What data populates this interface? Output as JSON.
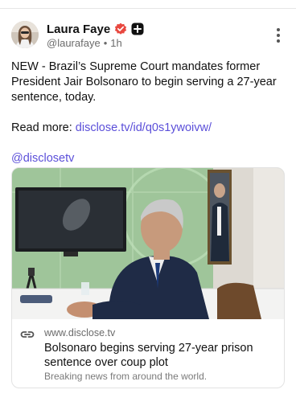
{
  "author": {
    "display_name": "Laura Faye",
    "handle": "@laurafaye",
    "separator": "•",
    "time_ago": "1h",
    "verified_icon": "verified-badge-icon",
    "plus_icon": "plus-badge-icon"
  },
  "post": {
    "text": "NEW - Brazil’s Supreme Court mandates former President Jair Bolsonaro to begin serving a 27-year sentence, today.",
    "read_more_label": "Read more:",
    "read_more_link": "disclose.tv/id/q0s1ywoivw/",
    "mention": "@disclosetv"
  },
  "link_card": {
    "domain": "www.disclose.tv",
    "title": "Bolsonaro begins serving 27-year prison sentence over coup plot",
    "description": "Breaking news from around the world."
  },
  "colors": {
    "link": "#5b4fd9",
    "verified": "#e8483f",
    "plus_badge": "#111111",
    "muted_text": "#6b6b6b"
  }
}
